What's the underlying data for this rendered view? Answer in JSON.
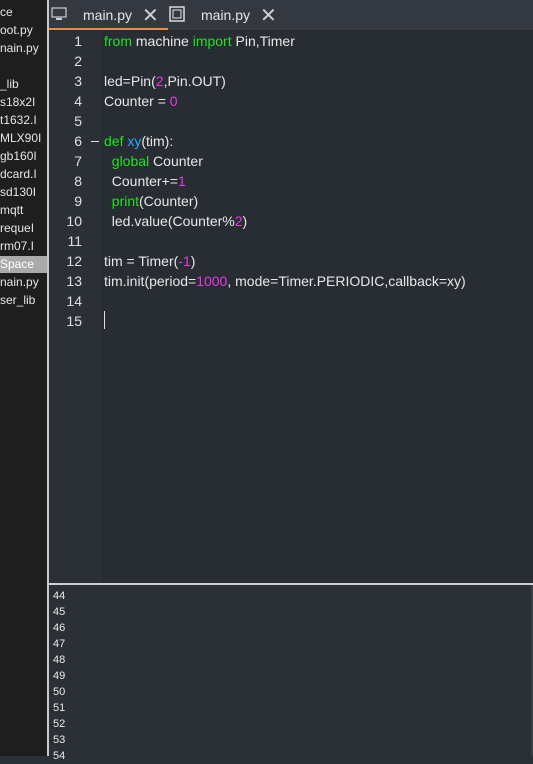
{
  "sidebar": {
    "items": [
      {
        "label": "ce"
      },
      {
        "label": "oot.py"
      },
      {
        "label": "nain.py"
      },
      {
        "label": ""
      },
      {
        "label": "_lib"
      },
      {
        "label": "s18x2I"
      },
      {
        "label": "t1632.I"
      },
      {
        "label": "MLX90I"
      },
      {
        "label": "gb160I"
      },
      {
        "label": "dcard.I"
      },
      {
        "label": "sd130I"
      },
      {
        "label": "mqtt"
      },
      {
        "label": "requeI"
      },
      {
        "label": "rm07.I"
      },
      {
        "label": "Space",
        "selected": true
      },
      {
        "label": "nain.py"
      },
      {
        "label": "ser_lib"
      }
    ]
  },
  "tabs": [
    {
      "label": "main.py",
      "active": true,
      "icon": "monitor-icon"
    },
    {
      "label": "main.py",
      "active": false,
      "icon": "board-icon"
    }
  ],
  "editor": {
    "line_numbers": [
      "1",
      "2",
      "3",
      "4",
      "5",
      "6",
      "7",
      "8",
      "9",
      "10",
      "11",
      "12",
      "13",
      "14",
      "15"
    ],
    "lines": [
      [
        {
          "t": "from",
          "c": "kw"
        },
        {
          "t": " machine ",
          "c": ""
        },
        {
          "t": "import",
          "c": "kw"
        },
        {
          "t": " Pin,Timer",
          "c": ""
        }
      ],
      [],
      [
        {
          "t": "led=Pin(",
          "c": ""
        },
        {
          "t": "2",
          "c": "num"
        },
        {
          "t": ",Pin.OUT)",
          "c": ""
        }
      ],
      [
        {
          "t": "Counter = ",
          "c": ""
        },
        {
          "t": "0",
          "c": "num"
        }
      ],
      [],
      [
        {
          "t": "def",
          "c": "kw"
        },
        {
          "t": " ",
          "c": ""
        },
        {
          "t": "xy",
          "c": "fn"
        },
        {
          "t": "(tim):",
          "c": ""
        }
      ],
      [
        {
          "t": "  ",
          "c": ""
        },
        {
          "t": "global",
          "c": "kw"
        },
        {
          "t": " Counter",
          "c": ""
        }
      ],
      [
        {
          "t": "  Counter+=",
          "c": ""
        },
        {
          "t": "1",
          "c": "num"
        }
      ],
      [
        {
          "t": "  ",
          "c": ""
        },
        {
          "t": "print",
          "c": "kw"
        },
        {
          "t": "(Counter)",
          "c": ""
        }
      ],
      [
        {
          "t": "  led.value(Counter%",
          "c": ""
        },
        {
          "t": "2",
          "c": "num"
        },
        {
          "t": ")",
          "c": ""
        }
      ],
      [],
      [
        {
          "t": "tim = Timer(",
          "c": ""
        },
        {
          "t": "-1",
          "c": "num"
        },
        {
          "t": ")",
          "c": ""
        }
      ],
      [
        {
          "t": "tim.init(period=",
          "c": ""
        },
        {
          "t": "1000",
          "c": "num"
        },
        {
          "t": ", mode=Timer.PERIODIC,callback=xy)",
          "c": ""
        }
      ],
      [],
      []
    ],
    "fold_line": 6
  },
  "console": {
    "lines": [
      "44",
      "45",
      "46",
      "47",
      "48",
      "49",
      "50",
      "51",
      "52",
      "53",
      "54"
    ]
  },
  "colors": {
    "accent": "#e88f3a",
    "keyword": "#1ee51e",
    "number": "#e63ae6",
    "function": "#2aa7ff"
  }
}
